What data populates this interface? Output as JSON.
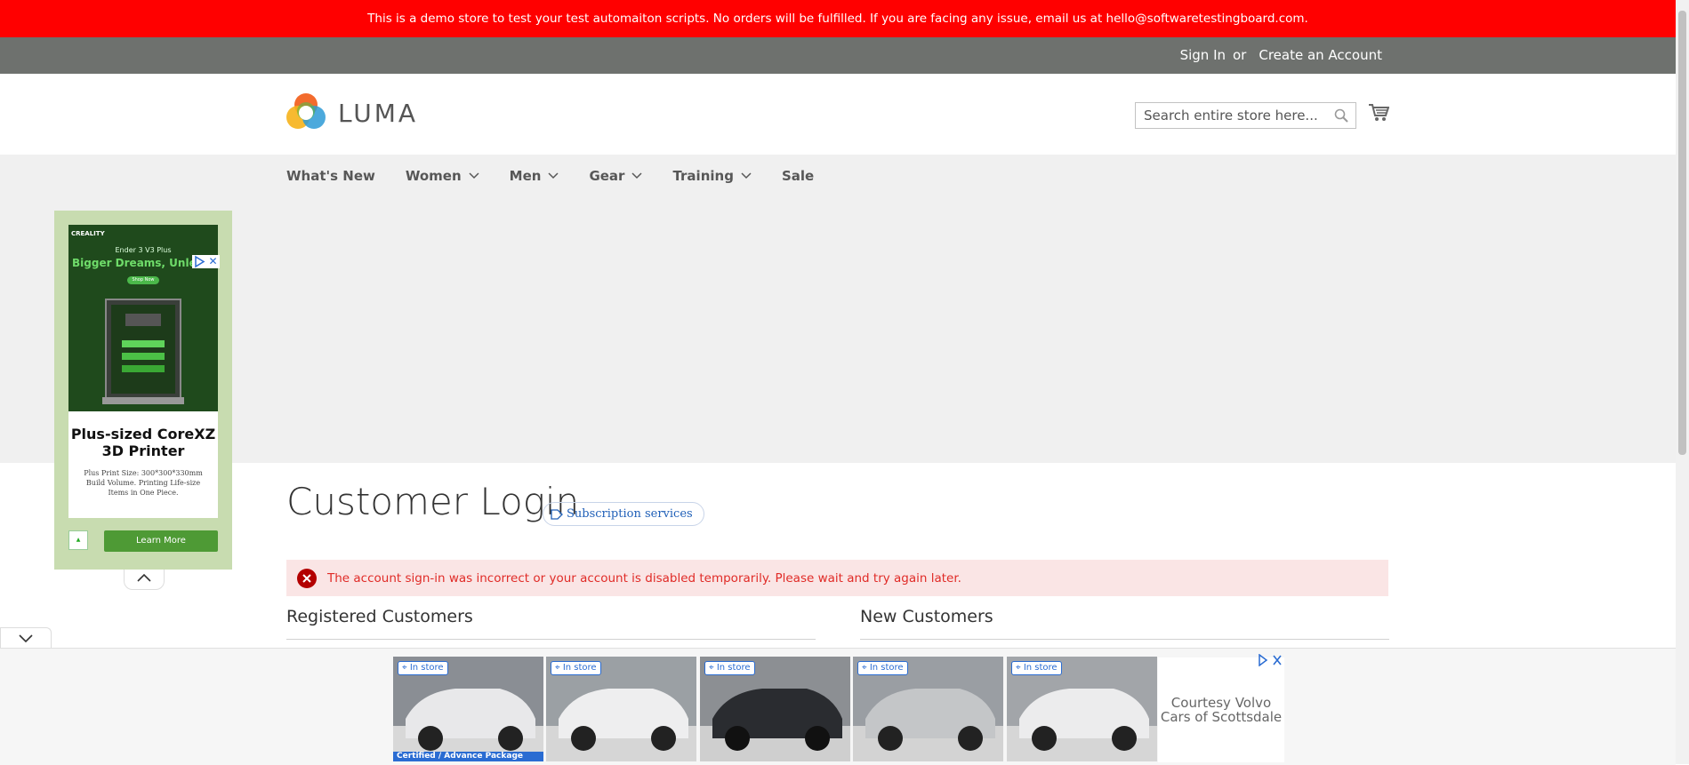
{
  "demo_notice": "This is a demo store to test your test automaiton scripts. No orders will be fulfilled. If you are facing any issue, email us at hello@softwaretestingboard.com.",
  "header": {
    "sign_in": "Sign In",
    "or": "or",
    "create_account": "Create an Account",
    "logo_text": "LUMA",
    "search_placeholder": "Search entire store here..."
  },
  "nav": {
    "items": [
      {
        "label": "What's New",
        "has_dropdown": false
      },
      {
        "label": "Women",
        "has_dropdown": true
      },
      {
        "label": "Men",
        "has_dropdown": true
      },
      {
        "label": "Gear",
        "has_dropdown": true
      },
      {
        "label": "Training",
        "has_dropdown": true
      },
      {
        "label": "Sale",
        "has_dropdown": false
      }
    ]
  },
  "side_ad": {
    "brand": "CREALITY",
    "model": "Ender 3 V3 Plus",
    "tagline": "Bigger Dreams, Unleash",
    "shop_now": "Shop Now",
    "title": "Plus-sized CoreXZ 3D Printer",
    "description": "Plus Print Size: 300*300*330mm Build Volume. Printing Life-size Items in One Piece.",
    "cta": "Learn More"
  },
  "main": {
    "page_title": "Customer Login",
    "subscription_badge": "Subscription services",
    "error_message": "The account sign-in was incorrect or your account is disabled temporarily. Please wait and try again later.",
    "registered_title": "Registered Customers",
    "new_title": "New Customers"
  },
  "bottom_ad": {
    "cars": [
      {
        "tag": "In store",
        "strip": "Certified / Advance Package",
        "color": "#e8e8ea"
      },
      {
        "tag": "In store",
        "strip": "",
        "color": "#eeeeef"
      },
      {
        "tag": "In store",
        "strip": "",
        "color": "#2a2c30"
      },
      {
        "tag": "In store",
        "strip": "",
        "color": "#c4c6c8"
      },
      {
        "tag": "In store",
        "strip": "",
        "color": "#ececed"
      }
    ],
    "courtesy": "Courtesy Volvo Cars of Scottsdale"
  },
  "colors": {
    "demo_bar": "#ff0000",
    "header_bar": "#6e716e",
    "nav_bg": "#f0f0f0",
    "error_bg": "#fae5e5",
    "error_text": "#e02b27",
    "link_blue": "#2a6cd2"
  }
}
